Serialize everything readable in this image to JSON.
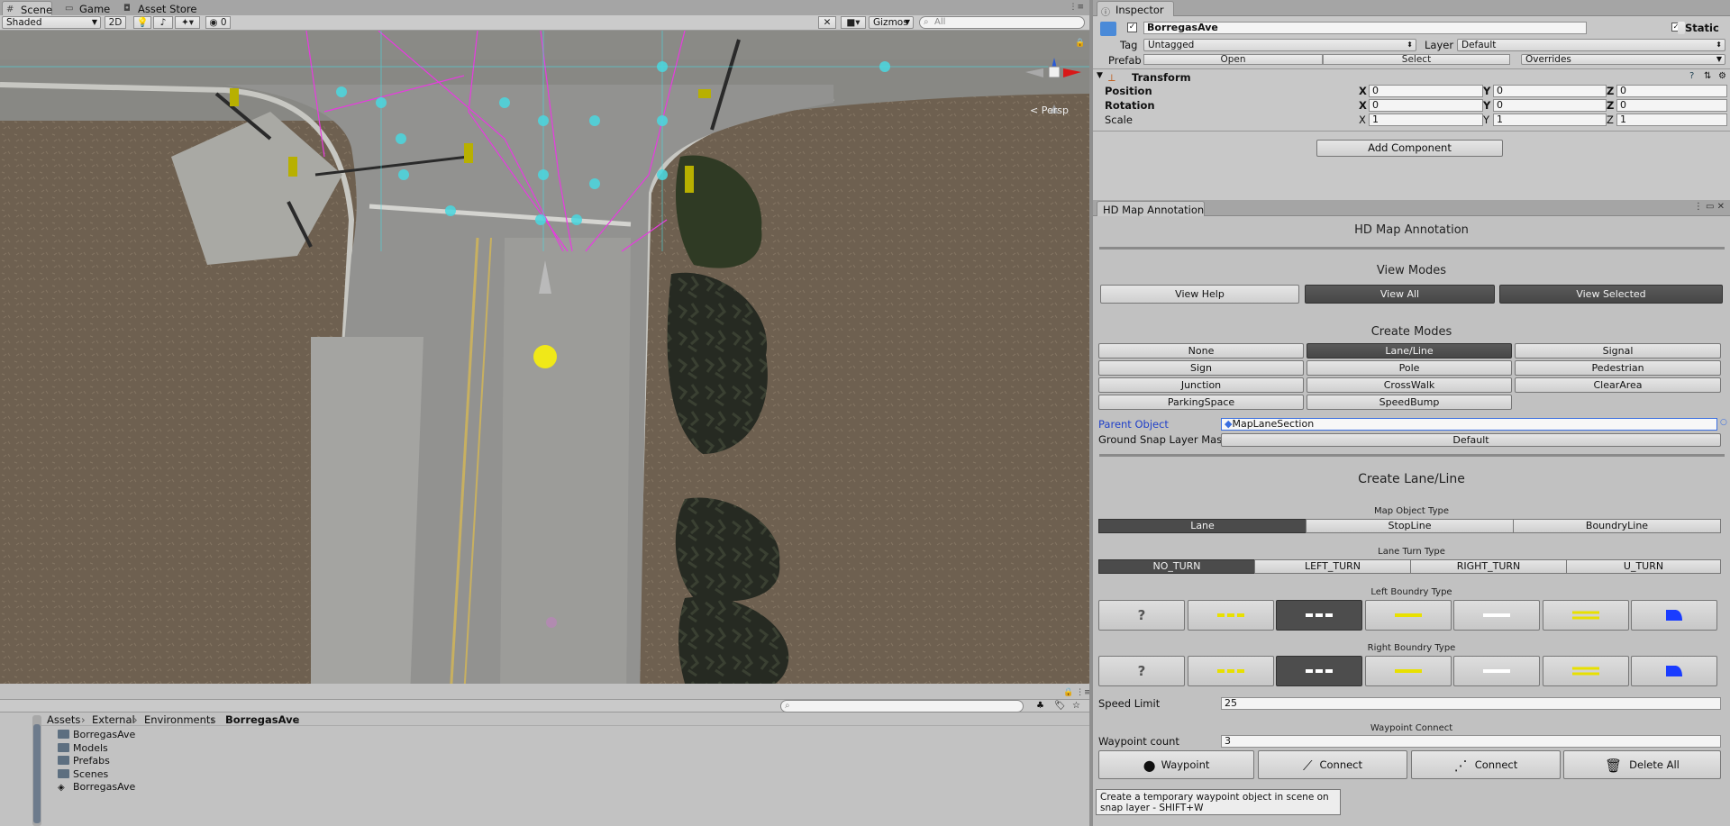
{
  "scene_tabs": {
    "scene": "Scene",
    "game": "Game",
    "asset_store": "Asset Store"
  },
  "scene_toolbar": {
    "shading": "Shaded",
    "mode_2d": "2D",
    "gizmos": "Gizmos",
    "search_placeholder": "All",
    "hidden_count": "0",
    "persp": "< Persp"
  },
  "inspector": {
    "tab": "Inspector",
    "object_name": "BorregasAve",
    "static_label": "Static",
    "tag_label": "Tag",
    "tag_value": "Untagged",
    "layer_label": "Layer",
    "layer_value": "Default",
    "prefab_label": "Prefab",
    "prefab_open": "Open",
    "prefab_select": "Select",
    "prefab_overrides": "Overrides",
    "transform_label": "Transform",
    "position_label": "Position",
    "rotation_label": "Rotation",
    "scale_label": "Scale",
    "position": {
      "x": "0",
      "y": "0",
      "z": "0"
    },
    "rotation": {
      "x": "0",
      "y": "0",
      "z": "0"
    },
    "scale": {
      "x": "1",
      "y": "1",
      "z": "1"
    },
    "axis": {
      "x": "X",
      "y": "Y",
      "z": "Z"
    },
    "add_component": "Add Component"
  },
  "annotation": {
    "tab": "HD Map Annotation",
    "title": "HD Map Annotation",
    "view_modes_title": "View Modes",
    "view_modes": [
      "View Help",
      "View All",
      "View Selected"
    ],
    "create_modes_title": "Create Modes",
    "create_modes": [
      "None",
      "Lane/Line",
      "Signal",
      "Sign",
      "Pole",
      "Pedestrian",
      "Junction",
      "CrossWalk",
      "ClearArea",
      "ParkingSpace",
      "SpeedBump"
    ],
    "parent_object_label": "Parent Object",
    "parent_object_value": "MapLaneSection",
    "ground_snap_label": "Ground Snap Layer Mask",
    "ground_snap_value": "Default",
    "create_title": "Create Lane/Line",
    "map_object_type_label": "Map Object Type",
    "map_object_types": [
      "Lane",
      "StopLine",
      "BoundryLine"
    ],
    "lane_turn_type_label": "Lane Turn Type",
    "lane_turn_types": [
      "NO_TURN",
      "LEFT_TURN",
      "RIGHT_TURN",
      "U_TURN"
    ],
    "left_boundry_label": "Left Boundry Type",
    "right_boundry_label": "Right Boundry Type",
    "unknown_glyph": "?",
    "speed_limit_label": "Speed Limit",
    "speed_limit_value": "25",
    "waypoint_connect_label": "Waypoint Connect",
    "waypoint_count_label": "Waypoint count",
    "waypoint_count_value": "3",
    "actions": [
      "Waypoint",
      "Connect",
      "Connect",
      "Delete All"
    ],
    "tooltip": "Create a temporary waypoint object in scene on snap layer - SHIFT+W"
  },
  "project": {
    "breadcrumb": [
      "Assets",
      "External",
      "Environments",
      "BorregasAve"
    ],
    "items": [
      {
        "name": "BorregasAve",
        "icon": "folder-icon"
      },
      {
        "name": "Models",
        "icon": "folder-icon"
      },
      {
        "name": "Prefabs",
        "icon": "folder-icon"
      },
      {
        "name": "Scenes",
        "icon": "folder-icon"
      },
      {
        "name": "BorregasAve",
        "icon": "unity-scene-icon"
      }
    ]
  },
  "colors": {
    "active_button": "#4b4b4b",
    "lane_yellow": "#e8e000",
    "lane_blue": "#1a3cff",
    "link_blue": "#2040c8"
  }
}
